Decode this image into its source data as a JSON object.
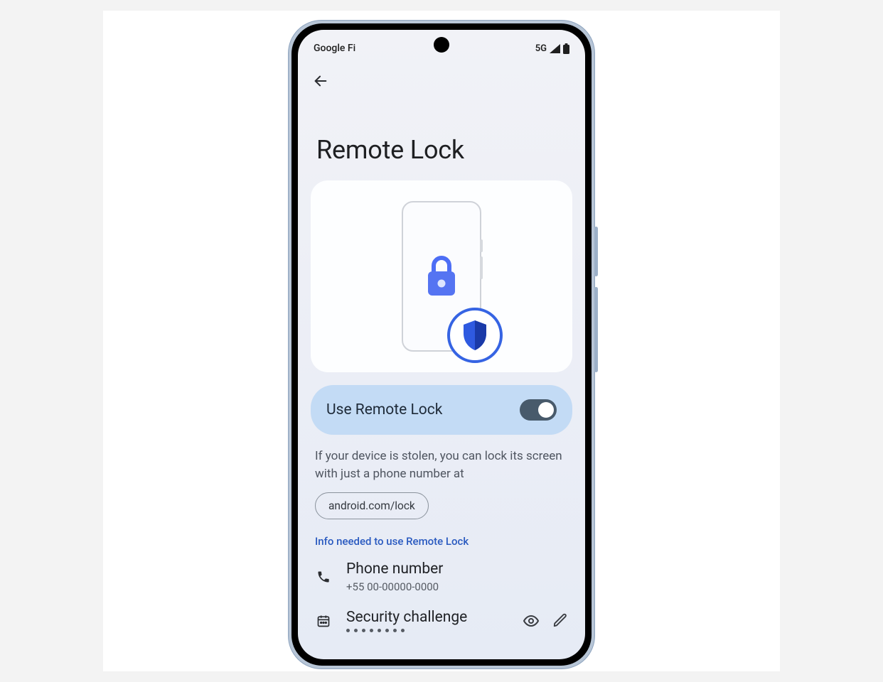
{
  "statusBar": {
    "carrier": "Google Fi",
    "network": "5G"
  },
  "page": {
    "title": "Remote Lock",
    "toggleLabel": "Use Remote Lock",
    "description": "If your device is stolen, you can lock its screen with just a phone number at",
    "linkChip": "android.com/lock",
    "sectionHeader": "Info needed to use Remote Lock"
  },
  "items": {
    "phone": {
      "title": "Phone number",
      "value": "+55 00-00000-0000"
    },
    "challenge": {
      "title": "Security challenge"
    }
  }
}
